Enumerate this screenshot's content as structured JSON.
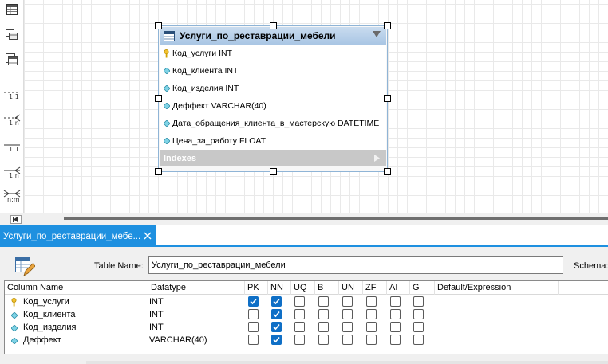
{
  "left_toolbar": {
    "tools": [
      {
        "name": "table-tool",
        "icon": "table-icon",
        "label": ""
      },
      {
        "name": "view-tool",
        "icon": "view-icon",
        "label": ""
      },
      {
        "name": "routine-group-tool",
        "icon": "routine-group-icon",
        "label": ""
      },
      {
        "name": "rel-1-1-nonid-tool",
        "icon": "relationship-icon",
        "label": "1:1"
      },
      {
        "name": "rel-1-n-nonid-tool",
        "icon": "relationship-icon",
        "label": "1:n"
      },
      {
        "name": "rel-1-1-id-tool",
        "icon": "relationship-icon",
        "label": "1:1"
      },
      {
        "name": "rel-1-n-id-tool",
        "icon": "relationship-icon",
        "label": "1:n"
      },
      {
        "name": "rel-n-m-tool",
        "icon": "relationship-icon",
        "label": "n:m"
      }
    ]
  },
  "entity": {
    "title": "Услуги_по_реставрации_мебели",
    "columns": [
      {
        "text": "Код_услуги INT",
        "icon": "key-icon"
      },
      {
        "text": "Код_клиента INT",
        "icon": "diamond-icon"
      },
      {
        "text": "Код_изделия INT",
        "icon": "diamond-icon"
      },
      {
        "text": "Деффект VARCHAR(40)",
        "icon": "diamond-icon"
      },
      {
        "text": "Дата_обращения_клиента_в_мастерскую DATETIME",
        "icon": "diamond-icon"
      },
      {
        "text": "Цена_за_работу FLOAT",
        "icon": "diamond-icon"
      }
    ],
    "indexes_label": "Indexes"
  },
  "tab": {
    "label": "Услуги_по_реставрации_мебе..."
  },
  "editor": {
    "table_name_label": "Table Name:",
    "table_name_value": "Услуги_по_реставрации_мебели",
    "schema_label": "Schema:"
  },
  "grid": {
    "headers": [
      "Column Name",
      "Datatype",
      "PK",
      "NN",
      "UQ",
      "B",
      "UN",
      "ZF",
      "AI",
      "G",
      "Default/Expression"
    ],
    "rows": [
      {
        "name": "Код_услуги",
        "type": "INT",
        "icon": "key-icon",
        "flags": [
          true,
          true,
          false,
          false,
          false,
          false,
          false,
          false
        ]
      },
      {
        "name": "Код_клиента",
        "type": "INT",
        "icon": "diamond-icon",
        "flags": [
          false,
          true,
          false,
          false,
          false,
          false,
          false,
          false
        ]
      },
      {
        "name": "Код_изделия",
        "type": "INT",
        "icon": "diamond-icon",
        "flags": [
          false,
          true,
          false,
          false,
          false,
          false,
          false,
          false
        ]
      },
      {
        "name": "Деффект",
        "type": "VARCHAR(40)",
        "icon": "diamond-icon",
        "flags": [
          false,
          true,
          false,
          false,
          false,
          false,
          false,
          false
        ]
      }
    ]
  },
  "colors": {
    "accent": "#1e90e0",
    "checked": "#0f6fc6",
    "header_blue": "#a9c6e4"
  }
}
